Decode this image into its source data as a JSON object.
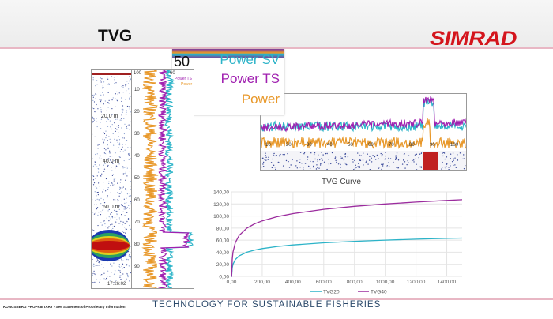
{
  "slide": {
    "title": "TVG",
    "logo": "SIMRAD",
    "footer_left": "KONGSBERG PROPRIETARY - See Statement of Proprietary Information",
    "slogan": "TECHNOLOGY FOR SUSTAINABLE FISHERIES"
  },
  "echogram": {
    "depth_labels": [
      "40.0 m",
      "60.0 m",
      "20.0 m"
    ],
    "time": "17:26:02"
  },
  "power_plot": {
    "legend": [
      "Power SV",
      "Power TS",
      "Power"
    ],
    "axis_top": [
      "100",
      "60"
    ],
    "depth_ticks": [
      "10",
      "20",
      "30",
      "40",
      "50",
      "60",
      "70",
      "80",
      "90"
    ]
  },
  "zoom_legend": {
    "sv": "Power SV",
    "ts": "Power TS",
    "p": "Power",
    "num": "50",
    "colors": {
      "sv": "#2bb3c8",
      "ts": "#a020b0",
      "p": "#e8982a"
    }
  },
  "horizontal_plot": {
    "ticks": [
      "10",
      "20",
      "30",
      "40",
      "50",
      "60",
      "70",
      "80",
      "90",
      "100"
    ],
    "range_labels": [
      "20.0 m",
      "40.0 m",
      "60.0 m"
    ]
  },
  "chart_data": {
    "type": "line",
    "title": "TVG Curve",
    "xlabel": "",
    "ylabel": "",
    "xlim": [
      0,
      1500
    ],
    "ylim": [
      0,
      140
    ],
    "xticks": [
      "0,00",
      "200,00",
      "400,00",
      "600,00",
      "800,00",
      "1000,00",
      "1200,00",
      "1400,00"
    ],
    "yticks": [
      "0,00",
      "20,00",
      "40,00",
      "60,00",
      "80,00",
      "100,00",
      "120,00",
      "140,00"
    ],
    "x": [
      1,
      5,
      10,
      25,
      50,
      100,
      150,
      200,
      300,
      400,
      600,
      800,
      1000,
      1200,
      1400,
      1500
    ],
    "series": [
      {
        "name": "TVG20",
        "color": "#2bb3c8",
        "values": [
          0,
          13.98,
          20,
          27.96,
          33.98,
          40,
          43.52,
          46.02,
          49.54,
          52.04,
          55.56,
          58.06,
          60,
          61.58,
          62.92,
          63.52
        ]
      },
      {
        "name": "TVG40",
        "color": "#9b2c9e",
        "values": [
          0,
          27.96,
          40,
          55.92,
          67.96,
          80,
          87.04,
          92.04,
          99.08,
          104.08,
          111.12,
          116.12,
          120,
          123.16,
          125.84,
          127.04
        ]
      }
    ],
    "legend": "bottom",
    "grid": true
  }
}
